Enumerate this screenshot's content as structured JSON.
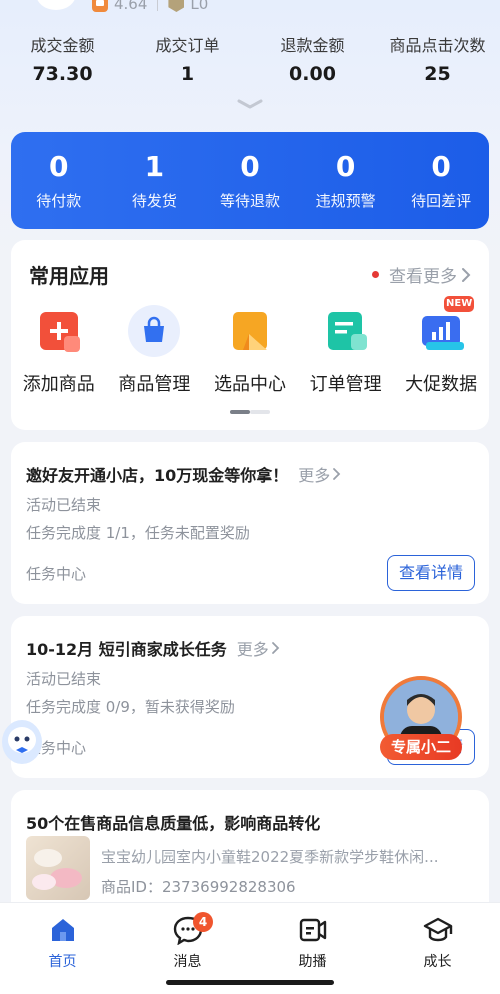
{
  "header": {
    "rating": "4.64",
    "level": "L0"
  },
  "stats": [
    {
      "label": "成交金额",
      "value": "73.30"
    },
    {
      "label": "成交订单",
      "value": "1"
    },
    {
      "label": "退款金额",
      "value": "0.00"
    },
    {
      "label": "商品点击次数",
      "value": "25"
    }
  ],
  "orders": [
    {
      "count": "0",
      "label": "待付款"
    },
    {
      "count": "1",
      "label": "待发货"
    },
    {
      "count": "0",
      "label": "等待退款"
    },
    {
      "count": "0",
      "label": "违规预警"
    },
    {
      "count": "0",
      "label": "待回差评"
    }
  ],
  "apps": {
    "title": "常用应用",
    "see_more": "查看更多",
    "items": [
      {
        "label": "添加商品",
        "icon": "add-product-icon"
      },
      {
        "label": "商品管理",
        "icon": "shopping-bag-icon"
      },
      {
        "label": "选品中心",
        "icon": "bookmark-icon"
      },
      {
        "label": "订单管理",
        "icon": "order-doc-icon"
      },
      {
        "label": "大促数据",
        "icon": "chart-screen-icon",
        "badge": "NEW"
      }
    ]
  },
  "tasks": [
    {
      "title": "邀好友开通小店，10万现金等你拿！",
      "more": "更多",
      "status": "活动已结束",
      "progress": "任务完成度 1/1，任务未配置奖励",
      "footer": "任务中心",
      "button": "查看详情"
    },
    {
      "title": "10-12月 短引商家成长任务",
      "more": "更多",
      "status": "活动已结束",
      "progress": "任务完成度 0/9，暂未获得奖励",
      "footer": "任务中心",
      "button": "查看详情"
    }
  ],
  "assistant": {
    "label": "专属小二"
  },
  "quality": {
    "title": "50个在售商品信息质量低，影响商品转化",
    "product_name": "宝宝幼儿园室内小童鞋2022夏季新款学步鞋休闲...",
    "product_id": "商品ID：23736992828306"
  },
  "tabbar": {
    "items": [
      {
        "label": "首页",
        "icon": "home-icon",
        "active": true
      },
      {
        "label": "消息",
        "icon": "message-icon"
      },
      {
        "label": "助播",
        "icon": "broadcast-icon"
      },
      {
        "label": "成长",
        "icon": "graduation-cap-icon"
      }
    ],
    "message_badge": "4"
  },
  "colors": {
    "primary": "#2b63d9",
    "order_bar": "#1c5de8",
    "badge": "#f0552e",
    "assistant": "#e83a24"
  }
}
